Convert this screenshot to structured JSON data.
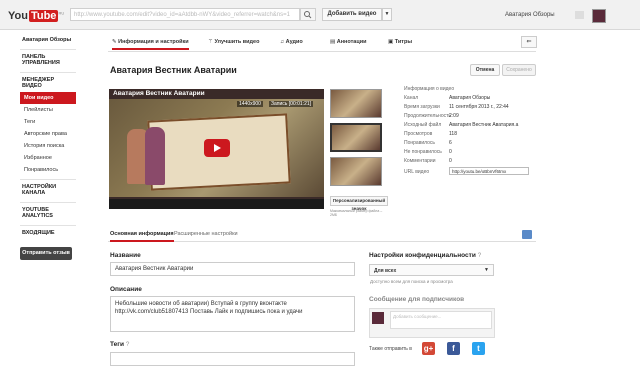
{
  "topbar": {
    "logo_you": "You",
    "logo_tube": "Tube",
    "logo_region": "RU",
    "url": "http://www.youtube.com/edit?video_id=aAtdbb-nWY&video_referrer=watch&ns=1",
    "upload_label": "Добавить видео",
    "user_name": "Аватария Обзоры"
  },
  "sidebar": {
    "channel_name": "Аватария Обзоры",
    "dashboard": "ПАНЕЛЬ УПРАВЛЕНИЯ",
    "manager": "МЕНЕДЖЕР ВИДЕО",
    "manager_items": [
      "Мои видео",
      "Плейлисты",
      "Теги",
      "Авторские права",
      "История поиска",
      "Избранное",
      "Понравилось"
    ],
    "channel_settings": "НАСТРОЙКИ КАНАЛА",
    "analytics": "YOUTUBE ANALYTICS",
    "inbox": "ВХОДЯЩИЕ",
    "feedback_button": "Отправить отзыв"
  },
  "tabs": {
    "info": "Информация и настройки",
    "enhance": "Улучшить видео",
    "audio": "Аудио",
    "annotations": "Аннотации",
    "captions": "Титры"
  },
  "video": {
    "title": "Аватария Вестник Аватарии",
    "cancel_label": "Отмена",
    "save_label": "Сохранено",
    "player_title": "Аватария Вестник Аватарии",
    "player_resolution": "1440x900",
    "player_rec": "Запись [00:01:21]",
    "thumb_button": "Персонализированный значок",
    "thumb_note": "Максимальный размер файла – 2МБ"
  },
  "info": {
    "header": "Информация о видео",
    "rows": [
      {
        "k": "Канал",
        "v": "Аватария Обзоры"
      },
      {
        "k": "Время загрузки",
        "v": "11 сентября 2013 г., 22:44"
      },
      {
        "k": "Продолжительность",
        "v": "2:09"
      },
      {
        "k": "Исходный файл",
        "v": "Аватария Вестник Аватария.a"
      },
      {
        "k": "Просмотров",
        "v": "118"
      },
      {
        "k": "Понравилось",
        "v": "6"
      },
      {
        "k": "Не понравилось",
        "v": "0"
      },
      {
        "k": "Комментарии",
        "v": "0"
      }
    ],
    "url_label": "URL видео",
    "url_value": "http://youtu.be/oBbnVf6tmx"
  },
  "subtabs": {
    "basic": "Основная информация",
    "advanced": "Расширенные настройки"
  },
  "form": {
    "name_label": "Название",
    "name_value": "Аватария Вестник Аватарии",
    "desc_label": "Описание",
    "desc_value": "Небольшие новости об аватарии) Вступай в группу вконтакте http://vk.com/club51807413 Поставь Лайк и подпишись пока и удачи",
    "tags_label": "Теги",
    "privacy_label": "Настройки конфиденциальности",
    "privacy_value": "Для всех",
    "privacy_hint": "Доступно всем для поиска и просмотра",
    "subs_label": "Сообщение для подписчиков",
    "subs_placeholder": "Добавить сообщение...",
    "share_label": "Также отправить в"
  }
}
